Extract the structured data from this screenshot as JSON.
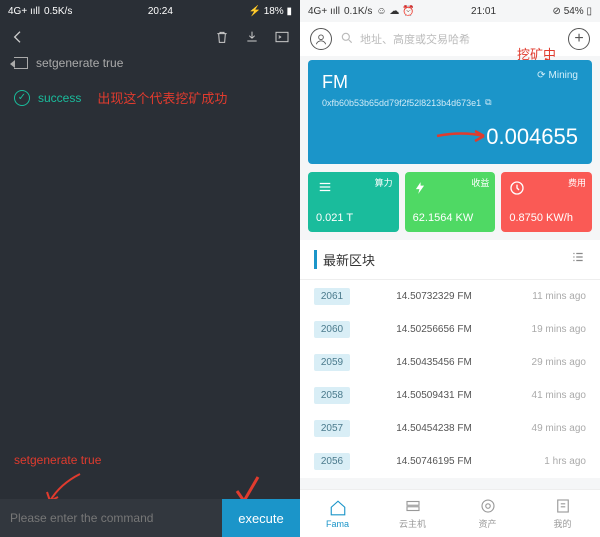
{
  "left": {
    "status": {
      "net": "4G+ ııll",
      "speed": "0.5K/s",
      "time": "20:24",
      "batt": "18%"
    },
    "echo": "setgenerate true",
    "success": "success",
    "annotation_success": "出现这个代表挖矿成功",
    "typed": "setgenerate true",
    "input_placeholder": "Please enter the command",
    "exec": "execute"
  },
  "right": {
    "status": {
      "net": "4G+ ııll",
      "speed": "0.1K/s",
      "time": "21:01",
      "batt": "54%"
    },
    "search_placeholder": "地址、高度或交易哈希",
    "annotation_mining": "挖矿中",
    "hero": {
      "symbol": "FM",
      "address": "0xfb60b53b65dd79f2f52l8213b4d673e1",
      "mining": "Mining",
      "balance": "0.004655"
    },
    "stats": [
      {
        "tag": "算力",
        "val": "0.021 T"
      },
      {
        "tag": "收益",
        "val": "62.1564 KW"
      },
      {
        "tag": "费用",
        "val": "0.8750 KW/h"
      }
    ],
    "blocks_title": "最新区块",
    "blocks": [
      {
        "n": "2061",
        "amt": "14.50732329 FM",
        "t": "11 mins ago"
      },
      {
        "n": "2060",
        "amt": "14.50256656 FM",
        "t": "19 mins ago"
      },
      {
        "n": "2059",
        "amt": "14.50435456 FM",
        "t": "29 mins ago"
      },
      {
        "n": "2058",
        "amt": "14.50509431 FM",
        "t": "41 mins ago"
      },
      {
        "n": "2057",
        "amt": "14.50454238 FM",
        "t": "49 mins ago"
      },
      {
        "n": "2056",
        "amt": "14.50746195 FM",
        "t": "1 hrs ago"
      }
    ],
    "tabs": [
      {
        "label": "Fama"
      },
      {
        "label": "云主机"
      },
      {
        "label": "资产"
      },
      {
        "label": "我的"
      }
    ]
  }
}
